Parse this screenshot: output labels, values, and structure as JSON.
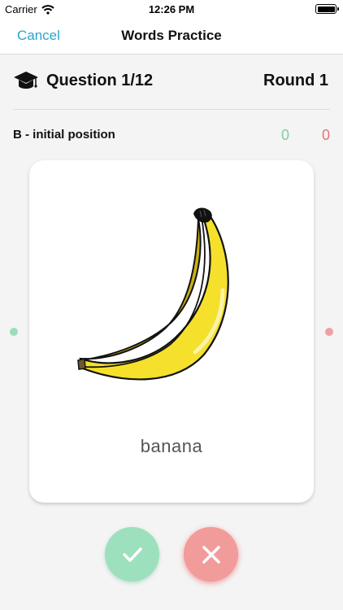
{
  "status_bar": {
    "carrier": "Carrier",
    "time": "12:26 PM"
  },
  "nav": {
    "cancel_label": "Cancel",
    "title": "Words Practice"
  },
  "header": {
    "question": "Question 1/12",
    "round": "Round 1"
  },
  "sound": {
    "label": "B - initial position",
    "correct_count": "0",
    "wrong_count": "0"
  },
  "card": {
    "word": "banana",
    "image": "banana-illustration"
  },
  "actions": {
    "correct_icon": "checkmark-icon",
    "wrong_icon": "cross-icon"
  },
  "colors": {
    "accent": "#2aa6c9",
    "correct": "#7fcfa4",
    "wrong": "#e97276",
    "correct_button": "#9de0bd",
    "wrong_button": "#f29b9b"
  }
}
